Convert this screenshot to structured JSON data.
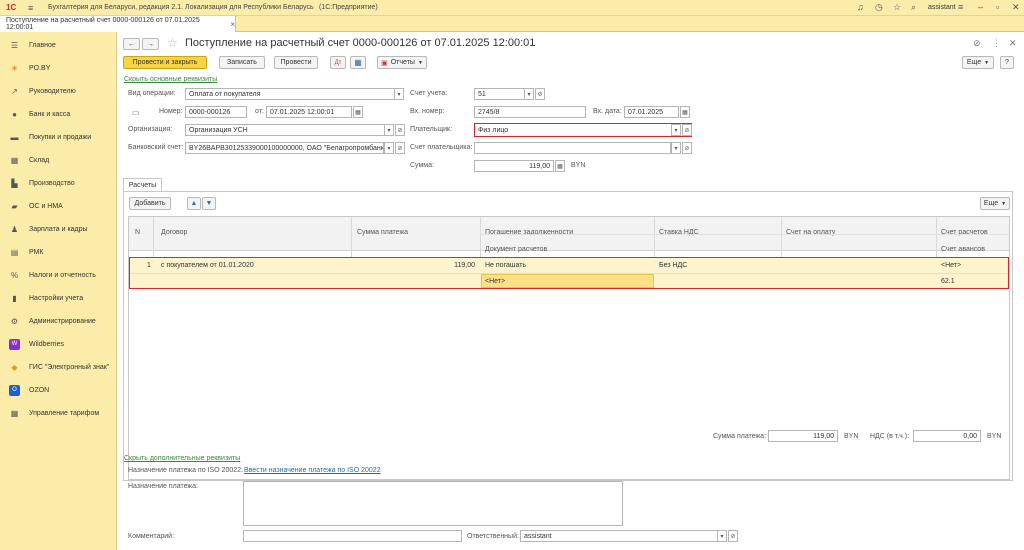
{
  "app": {
    "logo": "1С",
    "title": "Бухгалтерия для Беларуси, редакция 2.1. Локализация для Республики Беларусь",
    "platform": "(1С:Предприятие)",
    "user": "assistant"
  },
  "tab": {
    "label": "Поступление на расчетный счет 0000-000126 от 07.01.2025 12:00:01",
    "close": "×"
  },
  "sidebar": {
    "items": [
      {
        "label": "Главное",
        "icon": "menu-icon"
      },
      {
        "label": "PO.BY",
        "icon": "asterisk-icon"
      },
      {
        "label": "Руководителю",
        "icon": "trend-icon"
      },
      {
        "label": "Банк и касса",
        "icon": "coin-icon"
      },
      {
        "label": "Покупки и продажи",
        "icon": "cart-icon"
      },
      {
        "label": "Склад",
        "icon": "warehouse-icon"
      },
      {
        "label": "Производство",
        "icon": "factory-icon"
      },
      {
        "label": "ОС и НМА",
        "icon": "truck-icon"
      },
      {
        "label": "Зарплата и кадры",
        "icon": "person-icon"
      },
      {
        "label": "РМК",
        "icon": "register-icon"
      },
      {
        "label": "Налоги и отчетность",
        "icon": "percent-icon"
      },
      {
        "label": "Настройки учета",
        "icon": "book-icon"
      },
      {
        "label": "Администрирование",
        "icon": "gear-icon"
      },
      {
        "label": "Wildberries",
        "icon": "wb-icon"
      },
      {
        "label": "ГИС \"Электронный знак\"",
        "icon": "diamond-icon"
      },
      {
        "label": "OZON",
        "icon": "ozon-icon"
      },
      {
        "label": "Управление тарифом",
        "icon": "grid-icon"
      }
    ]
  },
  "doc": {
    "title": "Поступление на расчетный счет 0000-000126 от 07.01.2025 12:00:01",
    "toolbar": {
      "post_close": "Провести и закрыть",
      "save": "Записать",
      "post": "Провести",
      "reports": "Отчеты",
      "more": "Еще",
      "help": "?"
    },
    "hide_main": "Скрыть основные реквизиты",
    "fields": {
      "op_type_label": "Вид операции:",
      "op_type": "Оплата от покупателя",
      "number_label": "Номер:",
      "number": "0000-000126",
      "date_label": "от:",
      "date": "07.01.2025 12:00:01",
      "org_label": "Организация:",
      "org": "Организация УСН",
      "bank_label": "Банковский счет:",
      "bank": "BY26BAPB30125339000100000000, ОАО \"Белагропромбанк\"",
      "account_label": "Счет учета:",
      "account": "51",
      "in_number_label": "Вх. номер:",
      "in_number": "2745/8",
      "in_date_label": "Вх. дата:",
      "in_date": "07.01.2025",
      "payer_label": "Плательщик:",
      "payer": "Физ лицо",
      "payer_acc_label": "Счет плательщика:",
      "payer_acc": "",
      "sum_label": "Сумма:",
      "sum": "119,00",
      "currency": "BYN"
    },
    "tabs": {
      "payments": "Расчеты"
    },
    "table": {
      "add": "Добавить",
      "more": "Еще",
      "headers": {
        "n": "N",
        "contract": "Договор",
        "amount": "Сумма платежа",
        "debt": "Погашение задолженности",
        "doc": "Документ расчетов",
        "vat": "Ставка НДС",
        "invoice": "Счет на оплату",
        "acc_calc": "Счет расчетов",
        "acc_adv": "Счет авансов"
      },
      "rows": [
        {
          "n": "1",
          "contract": "с покупателем от 01.01.2020",
          "amount": "119,00",
          "debt": "Не погашать",
          "doc": "<Нет>",
          "vat": "Без НДС",
          "invoice": "",
          "acc_calc": "<Нет>",
          "acc_adv": "62.1"
        }
      ]
    },
    "totals": {
      "sum_label": "Сумма платежа:",
      "sum": "119,00",
      "currency": "BYN",
      "vat_label": "НДС (в т.ч.):",
      "vat": "0,00",
      "vat_currency": "BYN"
    },
    "hide_extra": "Скрыть дополнительные реквизиты",
    "iso_label": "Назначение платежа по ISO 20022:",
    "iso_link": "Ввести назначение платежа по ISO 20022",
    "purpose_label": "Назначение платежа:",
    "purpose": "",
    "comment_label": "Комментарий:",
    "comment": "",
    "responsible_label": "Ответственный:",
    "responsible": "assistant"
  }
}
